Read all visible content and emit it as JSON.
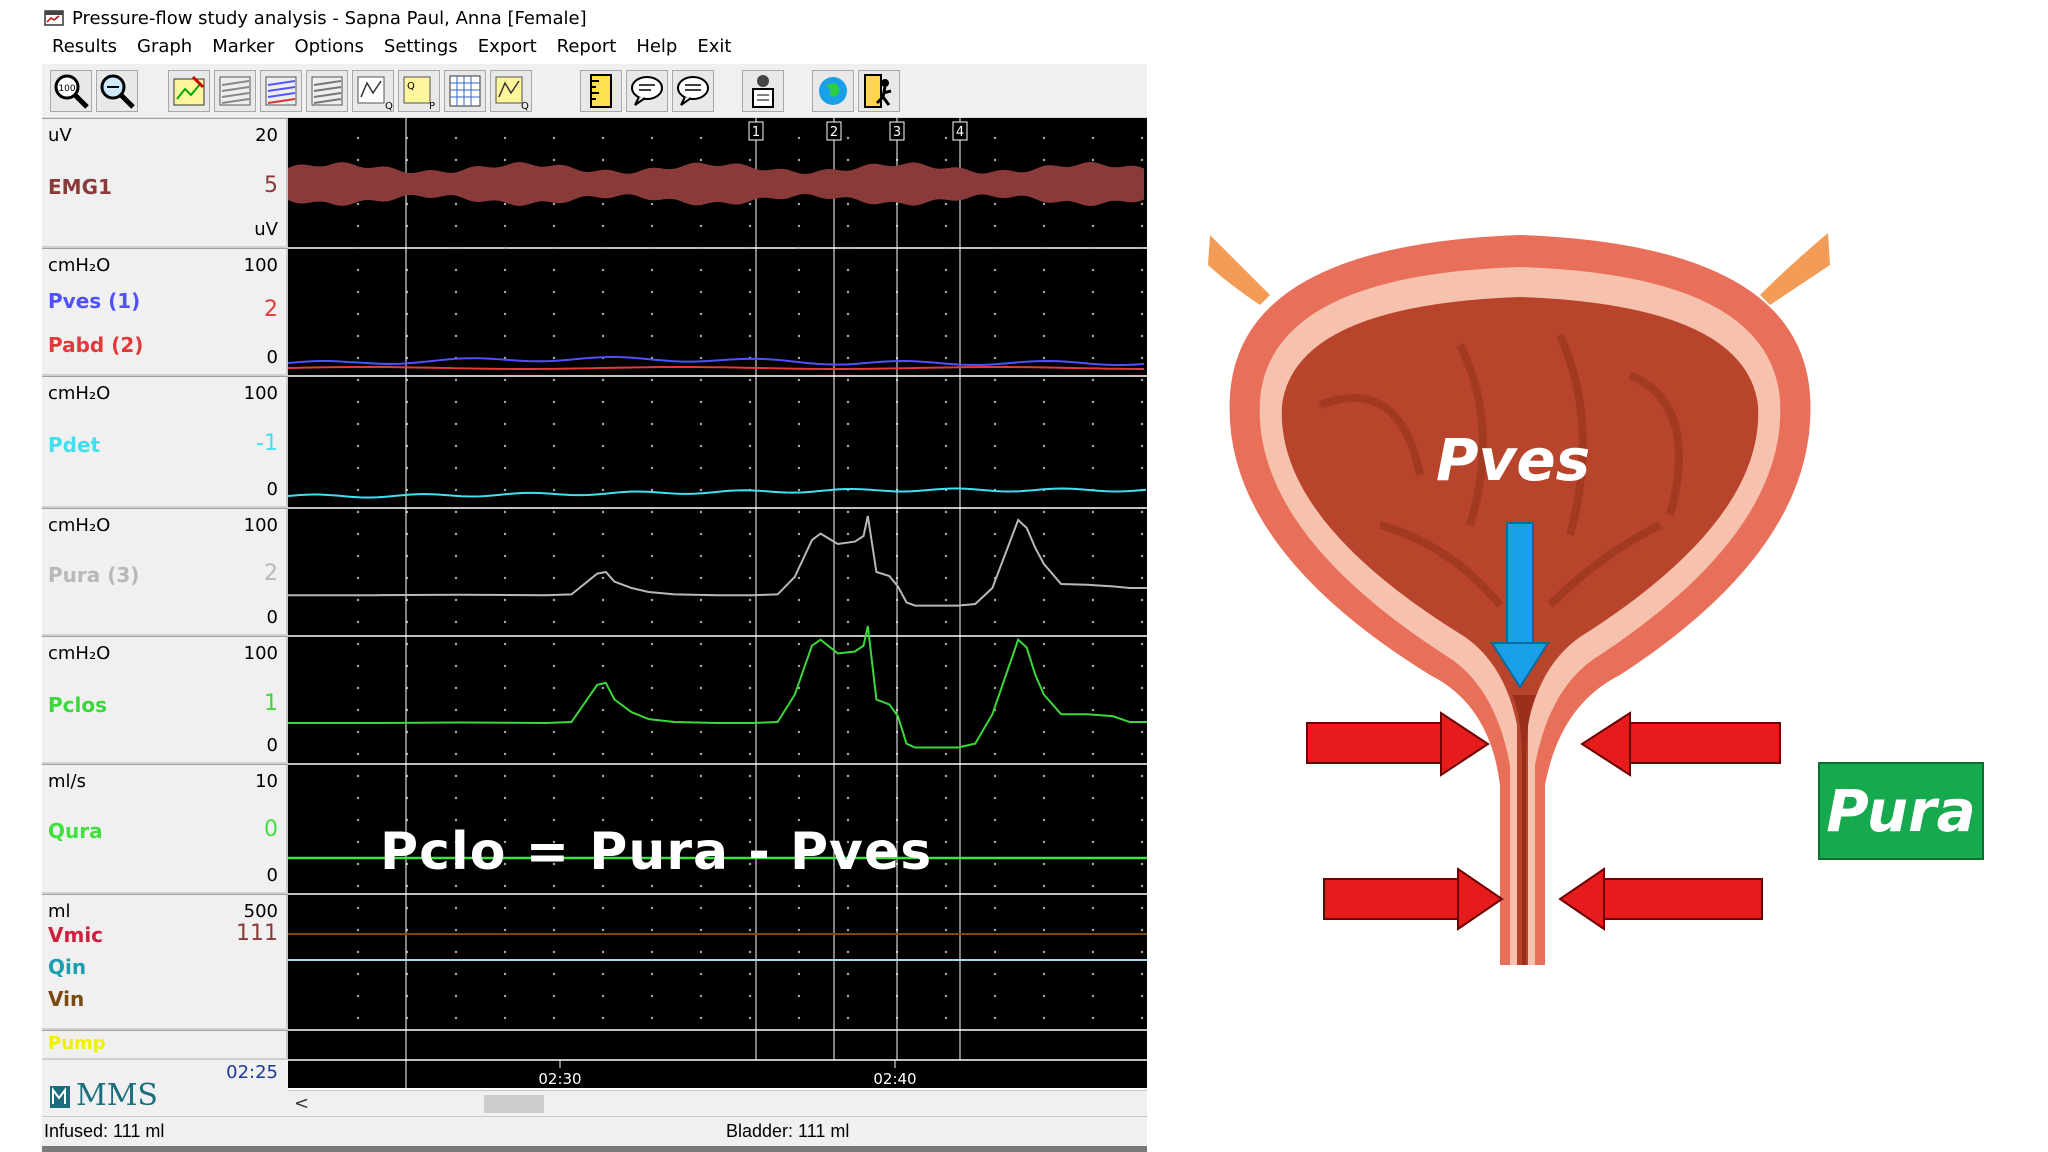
{
  "window": {
    "title": "Pressure-flow study analysis - Sapna Paul, Anna [Female]"
  },
  "menu": [
    "Results",
    "Graph",
    "Marker",
    "Options",
    "Settings",
    "Export",
    "Report",
    "Help",
    "Exit"
  ],
  "toolbar_icons": [
    "zoom-100-icon",
    "zoom-out-icon",
    "graph-edit-icon",
    "graph-icon-2",
    "graph-icon-3",
    "graph-icon-4",
    "graph-q-icon",
    "graph-qp-icon",
    "grid-icon",
    "graph-q2-icon",
    "ruler-icon",
    "comment-icon",
    "comment-list-icon",
    "patient-icon",
    "globe-icon",
    "exit-icon"
  ],
  "markers": [
    "1",
    "2",
    "3",
    "4"
  ],
  "channels": [
    {
      "unit": "uV",
      "max": "20",
      "min_unit": "uV",
      "rows": [
        {
          "name": "EMG1",
          "value": "5"
        }
      ]
    },
    {
      "unit": "cmH₂O",
      "max": "100",
      "min": "0",
      "rows": [
        {
          "name": "Pves (1)",
          "value": "2"
        },
        {
          "name": "Pabd (2)",
          "value": ""
        }
      ]
    },
    {
      "unit": "cmH₂O",
      "max": "100",
      "min": "0",
      "rows": [
        {
          "name": "Pdet",
          "value": "-1"
        }
      ]
    },
    {
      "unit": "cmH₂O",
      "max": "100",
      "min": "0",
      "rows": [
        {
          "name": "Pura (3)",
          "value": "2"
        }
      ]
    },
    {
      "unit": "cmH₂O",
      "max": "100",
      "min": "0",
      "rows": [
        {
          "name": "Pclos",
          "value": "1"
        }
      ]
    },
    {
      "unit": "ml/s",
      "max": "10",
      "min": "0",
      "rows": [
        {
          "name": "Qura",
          "value": "0"
        }
      ]
    },
    {
      "unit": "ml",
      "max": "500",
      "rows": [
        {
          "name": "Vmic",
          "value": "111"
        },
        {
          "name": "Qin",
          "value": ""
        },
        {
          "name": "Vin",
          "value": ""
        }
      ]
    },
    {
      "rows": [
        {
          "name": "Pump",
          "value": ""
        }
      ]
    }
  ],
  "colors": {
    "emg": "#8b3a3a",
    "pves": "#5050ff",
    "pabd": "#e03a3a",
    "pdet": "#40e0f0",
    "pura": "#b8b8b8",
    "pclos": "#3ad83a",
    "qura": "#40e040",
    "vmic": "#d02040",
    "qin": "#1aa0b0",
    "vin": "#7a4a10",
    "pump": "#f0f000",
    "pura_box": "#16a94e"
  },
  "time": {
    "current": "02:25",
    "ticks": [
      "02:30",
      "02:40"
    ]
  },
  "logo": "MMS",
  "status": {
    "infused": "Infused: 111 ml",
    "bladder": "Bladder: 111 ml"
  },
  "overlay": {
    "formula_left": "Pclo",
    "formula_eq": " = ",
    "formula_mid": "Pura",
    "formula_minus": " - ",
    "formula_right": "Pves"
  },
  "illustration": {
    "pves_label": "Pves",
    "pura_label": "Pura"
  },
  "traces": {
    "pura": [
      [
        0,
        1
      ],
      [
        0.1,
        1
      ],
      [
        0.2,
        1.5
      ],
      [
        0.3,
        1
      ],
      [
        0.33,
        2
      ],
      [
        0.36,
        28
      ],
      [
        0.37,
        30
      ],
      [
        0.38,
        18
      ],
      [
        0.4,
        10
      ],
      [
        0.42,
        5
      ],
      [
        0.45,
        2
      ],
      [
        0.5,
        1
      ],
      [
        0.54,
        1
      ],
      [
        0.57,
        2
      ],
      [
        0.59,
        24
      ],
      [
        0.61,
        70
      ],
      [
        0.62,
        78
      ],
      [
        0.64,
        65
      ],
      [
        0.66,
        68
      ],
      [
        0.67,
        75
      ],
      [
        0.675,
        100
      ],
      [
        0.685,
        30
      ],
      [
        0.7,
        25
      ],
      [
        0.71,
        12
      ],
      [
        0.72,
        -8
      ],
      [
        0.73,
        -12
      ],
      [
        0.78,
        -12
      ],
      [
        0.8,
        -10
      ],
      [
        0.82,
        10
      ],
      [
        0.85,
        95
      ],
      [
        0.86,
        85
      ],
      [
        0.87,
        60
      ],
      [
        0.88,
        40
      ],
      [
        0.9,
        15
      ],
      [
        0.93,
        14
      ],
      [
        0.96,
        12
      ],
      [
        0.98,
        10
      ],
      [
        1,
        10
      ]
    ],
    "pclos": [
      [
        0,
        1
      ],
      [
        0.1,
        1
      ],
      [
        0.2,
        1.5
      ],
      [
        0.3,
        1
      ],
      [
        0.33,
        2
      ],
      [
        0.36,
        40
      ],
      [
        0.37,
        42
      ],
      [
        0.38,
        25
      ],
      [
        0.4,
        12
      ],
      [
        0.42,
        5
      ],
      [
        0.45,
        2
      ],
      [
        0.5,
        1
      ],
      [
        0.54,
        1
      ],
      [
        0.57,
        2
      ],
      [
        0.59,
        30
      ],
      [
        0.61,
        80
      ],
      [
        0.62,
        86
      ],
      [
        0.64,
        72
      ],
      [
        0.66,
        74
      ],
      [
        0.67,
        80
      ],
      [
        0.675,
        100
      ],
      [
        0.685,
        25
      ],
      [
        0.7,
        20
      ],
      [
        0.71,
        8
      ],
      [
        0.72,
        -20
      ],
      [
        0.73,
        -24
      ],
      [
        0.78,
        -24
      ],
      [
        0.8,
        -20
      ],
      [
        0.82,
        10
      ],
      [
        0.85,
        86
      ],
      [
        0.86,
        78
      ],
      [
        0.87,
        50
      ],
      [
        0.88,
        30
      ],
      [
        0.9,
        10
      ],
      [
        0.93,
        10
      ],
      [
        0.96,
        8
      ],
      [
        0.98,
        2
      ],
      [
        1,
        2
      ]
    ]
  }
}
